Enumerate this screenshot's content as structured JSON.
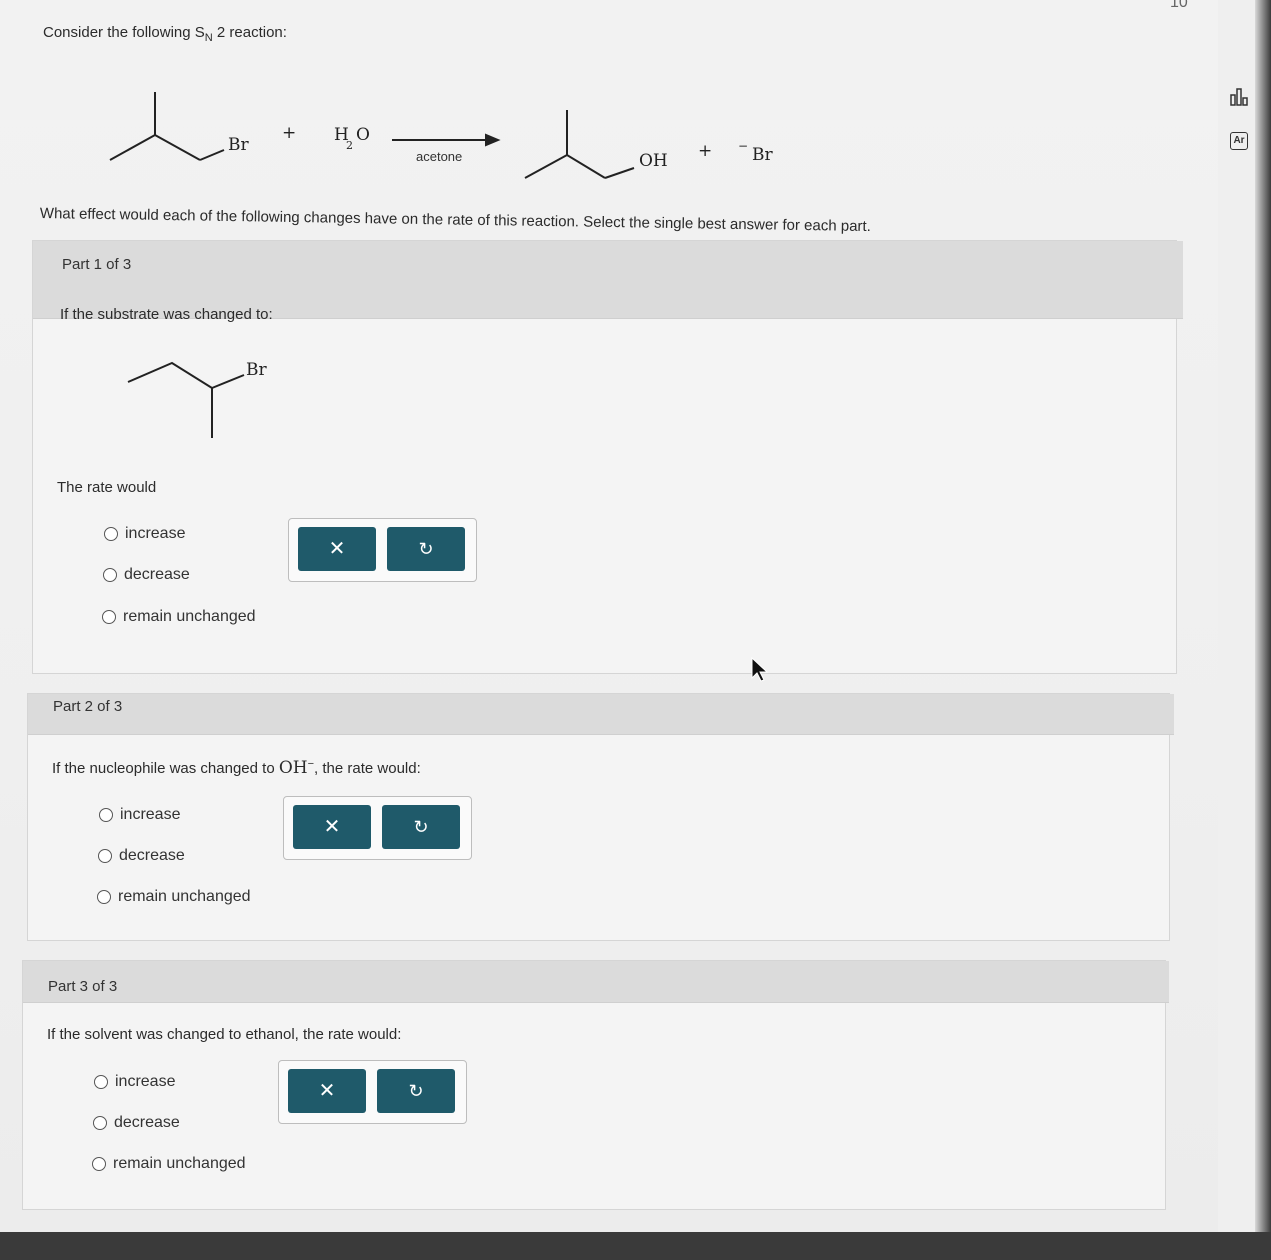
{
  "question": {
    "intro_prefix": "Consider the following S",
    "intro_sub": "N",
    "intro_suffix": "2 reaction:",
    "prompt": "What effect would each of the following changes have on the rate of this reaction. Select the single best answer for each part."
  },
  "reaction": {
    "reactant_label": "Br",
    "plus": "+",
    "water_h": "H",
    "water_sub": "2",
    "water_o": "O",
    "conditions": "acetone",
    "product_label": "OH",
    "plus2": "+",
    "byproduct_charge": "−",
    "byproduct": "Br"
  },
  "parts": [
    {
      "label": "Part 1 of 3",
      "question": "If the substrate was changed to:",
      "substrate_label": "Br",
      "lead": "The rate would",
      "options": [
        "increase",
        "decrease",
        "remain unchanged"
      ],
      "buttons": {
        "clear": "✕",
        "reset": "↻"
      }
    },
    {
      "label": "Part 2 of 3",
      "question_prefix": "If the nucleophile was changed to ",
      "nucleophile": "OH",
      "nucleophile_charge": "−",
      "question_suffix": ", the rate would:",
      "options": [
        "increase",
        "decrease",
        "remain unchanged"
      ],
      "buttons": {
        "clear": "✕",
        "reset": "↻"
      }
    },
    {
      "label": "Part 3 of 3",
      "question": "If the solvent was changed to ethanol, the rate would:",
      "options": [
        "increase",
        "decrease",
        "remain unchanged"
      ],
      "buttons": {
        "clear": "✕",
        "reset": "↻"
      }
    }
  ],
  "sidebar": {
    "counter": "10",
    "icons": [
      "bar-chart-icon",
      "periodic-table-icon"
    ],
    "ar_text": "Ar"
  },
  "colors": {
    "button": "#1f5a6a",
    "header": "#dbdbdb"
  }
}
